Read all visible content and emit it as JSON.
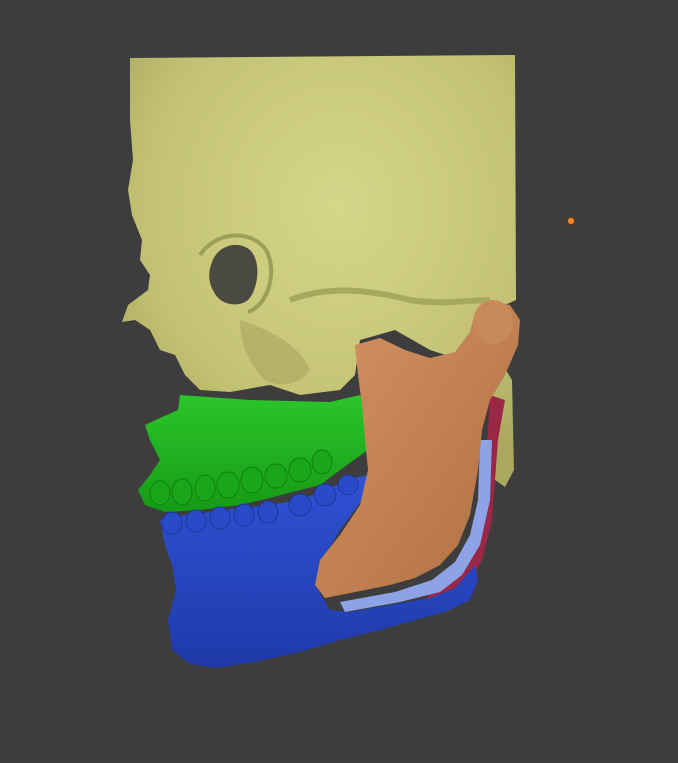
{
  "viewport": {
    "background": "#3d3d3d"
  },
  "model": {
    "parts": [
      {
        "name": "skull",
        "color": "#c9c878"
      },
      {
        "name": "maxilla",
        "color": "#1fb21f"
      },
      {
        "name": "mandible",
        "color": "#2a48c4"
      },
      {
        "name": "ramus-segment",
        "color": "#c88250"
      },
      {
        "name": "implant-plate",
        "color": "#8ea2e6"
      },
      {
        "name": "posterior-segment",
        "color": "#9b2746"
      }
    ]
  },
  "origin_marker": {
    "icon": "object-origin-icon",
    "color": "#f28a2b"
  }
}
